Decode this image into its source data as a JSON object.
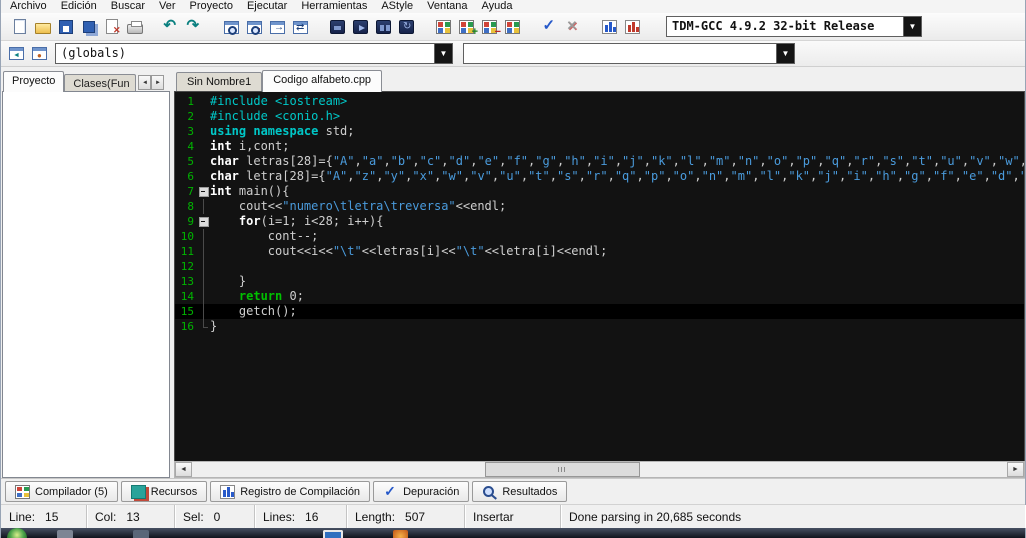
{
  "menu": {
    "items": [
      {
        "label": "Archivo",
        "name": "menu-archivo"
      },
      {
        "label": "Edición",
        "name": "menu-edicion"
      },
      {
        "label": "Buscar",
        "name": "menu-buscar"
      },
      {
        "label": "Ver",
        "name": "menu-ver"
      },
      {
        "label": "Proyecto",
        "name": "menu-proyecto"
      },
      {
        "label": "Ejecutar",
        "name": "menu-ejecutar"
      },
      {
        "label": "Herramientas",
        "name": "menu-herramientas"
      },
      {
        "label": "AStyle",
        "name": "menu-astyle"
      },
      {
        "label": "Ventana",
        "name": "menu-ventana"
      },
      {
        "label": "Ayuda",
        "name": "menu-ayuda"
      }
    ]
  },
  "toolbar1": {
    "groups": [
      {
        "icons": [
          "new-file",
          "open-file",
          "save",
          "save-all",
          "close-file",
          "print"
        ]
      },
      {
        "icons": [
          "undo",
          "redo"
        ]
      },
      {
        "icons": [
          "find",
          "replace",
          "goto-line",
          "swap-header-source"
        ]
      },
      {
        "icons": [
          "compile",
          "run",
          "compile-run",
          "rebuild"
        ]
      },
      {
        "icons": [
          "new-source-file",
          "add-to-project",
          "remove-from-project",
          "project-options"
        ]
      },
      {
        "icons": [
          "syntax-check",
          "abort-compilation"
        ]
      },
      {
        "icons": [
          "profile-analysis",
          "delete-profiling-data"
        ]
      }
    ],
    "compiler_profile": "TDM-GCC 4.9.2 32-bit Release",
    "dropdown_arrow": "▼"
  },
  "toolbar2": {
    "icons": [
      "goto-declaration",
      "goto-definition"
    ],
    "globals_value": "(globals)",
    "members_value": "",
    "dropdown_arrow": "▼"
  },
  "left_panel": {
    "tabs": [
      {
        "label": "Proyecto",
        "active": true
      },
      {
        "label": "Clases(Fun",
        "active": false
      }
    ],
    "scroll_left_icon": "◄",
    "scroll_right_icon": "►"
  },
  "editor": {
    "tabs": [
      {
        "label": "Sin Nombre1",
        "active": false
      },
      {
        "label": "Codigo alfabeto.cpp",
        "active": true
      }
    ],
    "current_line": 15,
    "lines": [
      {
        "n": 1,
        "tk": [
          [
            "#include <iostream>",
            "pp"
          ]
        ]
      },
      {
        "n": 2,
        "tk": [
          [
            "#include <conio.h>",
            "pp"
          ]
        ]
      },
      {
        "n": 3,
        "tk": [
          [
            "using namespace",
            "kwc"
          ],
          [
            " std;",
            "txt"
          ]
        ]
      },
      {
        "n": 4,
        "tk": [
          [
            "int",
            "kw"
          ],
          [
            " i,cont;",
            "txt"
          ]
        ]
      },
      {
        "n": 5,
        "tk": [
          [
            "char",
            "kw"
          ],
          [
            " letras[28]={",
            "txt"
          ],
          [
            "\"A\"",
            "str"
          ],
          [
            ",",
            "txt"
          ],
          [
            "\"a\"",
            "str"
          ],
          [
            ",",
            "txt"
          ],
          [
            "\"b\"",
            "str"
          ],
          [
            ",",
            "txt"
          ],
          [
            "\"c\"",
            "str"
          ],
          [
            ",",
            "txt"
          ],
          [
            "\"d\"",
            "str"
          ],
          [
            ",",
            "txt"
          ],
          [
            "\"e\"",
            "str"
          ],
          [
            ",",
            "txt"
          ],
          [
            "\"f\"",
            "str"
          ],
          [
            ",",
            "txt"
          ],
          [
            "\"g\"",
            "str"
          ],
          [
            ",",
            "txt"
          ],
          [
            "\"h\"",
            "str"
          ],
          [
            ",",
            "txt"
          ],
          [
            "\"i\"",
            "str"
          ],
          [
            ",",
            "txt"
          ],
          [
            "\"j\"",
            "str"
          ],
          [
            ",",
            "txt"
          ],
          [
            "\"k\"",
            "str"
          ],
          [
            ",",
            "txt"
          ],
          [
            "\"l\"",
            "str"
          ],
          [
            ",",
            "txt"
          ],
          [
            "\"m\"",
            "str"
          ],
          [
            ",",
            "txt"
          ],
          [
            "\"n\"",
            "str"
          ],
          [
            ",",
            "txt"
          ],
          [
            "\"o\"",
            "str"
          ],
          [
            ",",
            "txt"
          ],
          [
            "\"p\"",
            "str"
          ],
          [
            ",",
            "txt"
          ],
          [
            "\"q\"",
            "str"
          ],
          [
            ",",
            "txt"
          ],
          [
            "\"r\"",
            "str"
          ],
          [
            ",",
            "txt"
          ],
          [
            "\"s\"",
            "str"
          ],
          [
            ",",
            "txt"
          ],
          [
            "\"t\"",
            "str"
          ],
          [
            ",",
            "txt"
          ],
          [
            "\"u\"",
            "str"
          ],
          [
            ",",
            "txt"
          ],
          [
            "\"v\"",
            "str"
          ],
          [
            ",",
            "txt"
          ],
          [
            "\"w\"",
            "str"
          ],
          [
            ",",
            "txt"
          ],
          [
            "\"x",
            "str"
          ]
        ]
      },
      {
        "n": 6,
        "tk": [
          [
            "char",
            "kw"
          ],
          [
            " letra[28]={",
            "txt"
          ],
          [
            "\"A\"",
            "str"
          ],
          [
            ",",
            "txt"
          ],
          [
            "\"z\"",
            "str"
          ],
          [
            ",",
            "txt"
          ],
          [
            "\"y\"",
            "str"
          ],
          [
            ",",
            "txt"
          ],
          [
            "\"x\"",
            "str"
          ],
          [
            ",",
            "txt"
          ],
          [
            "\"w\"",
            "str"
          ],
          [
            ",",
            "txt"
          ],
          [
            "\"v\"",
            "str"
          ],
          [
            ",",
            "txt"
          ],
          [
            "\"u\"",
            "str"
          ],
          [
            ",",
            "txt"
          ],
          [
            "\"t\"",
            "str"
          ],
          [
            ",",
            "txt"
          ],
          [
            "\"s\"",
            "str"
          ],
          [
            ",",
            "txt"
          ],
          [
            "\"r\"",
            "str"
          ],
          [
            ",",
            "txt"
          ],
          [
            "\"q\"",
            "str"
          ],
          [
            ",",
            "txt"
          ],
          [
            "\"p\"",
            "str"
          ],
          [
            ",",
            "txt"
          ],
          [
            "\"o\"",
            "str"
          ],
          [
            ",",
            "txt"
          ],
          [
            "\"n\"",
            "str"
          ],
          [
            ",",
            "txt"
          ],
          [
            "\"m\"",
            "str"
          ],
          [
            ",",
            "txt"
          ],
          [
            "\"l\"",
            "str"
          ],
          [
            ",",
            "txt"
          ],
          [
            "\"k\"",
            "str"
          ],
          [
            ",",
            "txt"
          ],
          [
            "\"j\"",
            "str"
          ],
          [
            ",",
            "txt"
          ],
          [
            "\"i\"",
            "str"
          ],
          [
            ",",
            "txt"
          ],
          [
            "\"h\"",
            "str"
          ],
          [
            ",",
            "txt"
          ],
          [
            "\"g\"",
            "str"
          ],
          [
            ",",
            "txt"
          ],
          [
            "\"f\"",
            "str"
          ],
          [
            ",",
            "txt"
          ],
          [
            "\"e\"",
            "str"
          ],
          [
            ",",
            "txt"
          ],
          [
            "\"d\"",
            "str"
          ],
          [
            ",",
            "txt"
          ],
          [
            "\"c",
            "str"
          ]
        ]
      },
      {
        "n": 7,
        "fold": "box",
        "tk": [
          [
            "int",
            "kw"
          ],
          [
            " main(){",
            "txt"
          ]
        ]
      },
      {
        "n": 8,
        "fold": "line",
        "tk": [
          [
            "    cout<<",
            "txt"
          ],
          [
            "\"numero\\tletra\\treversa\"",
            "str"
          ],
          [
            "<<endl;",
            "txt"
          ]
        ]
      },
      {
        "n": 9,
        "fold": "box",
        "tk": [
          [
            "    ",
            "txt"
          ],
          [
            "for",
            "kw"
          ],
          [
            "(i=1; i<28; i++){",
            "txt"
          ]
        ]
      },
      {
        "n": 10,
        "fold": "line",
        "tk": [
          [
            "        cont--;",
            "txt"
          ]
        ]
      },
      {
        "n": 11,
        "fold": "line",
        "tk": [
          [
            "        cout<<i<<",
            "txt"
          ],
          [
            "\"\\t\"",
            "str"
          ],
          [
            "<<letras[i]<<",
            "txt"
          ],
          [
            "\"\\t\"",
            "str"
          ],
          [
            "<<letra[i]<<endl;",
            "txt"
          ]
        ]
      },
      {
        "n": 12,
        "fold": "line",
        "tk": []
      },
      {
        "n": 13,
        "fold": "line",
        "tk": [
          [
            "    }",
            "txt"
          ]
        ]
      },
      {
        "n": 14,
        "fold": "line",
        "tk": [
          [
            "    ",
            "txt"
          ],
          [
            "return",
            "kwg"
          ],
          [
            " 0;",
            "txt"
          ]
        ]
      },
      {
        "n": 15,
        "fold": "line",
        "tk": [
          [
            "    getch();",
            "txt"
          ]
        ]
      },
      {
        "n": 16,
        "fold": "end",
        "tk": [
          [
            "}",
            "txt"
          ]
        ]
      }
    ]
  },
  "scrollbar": {
    "left_arrow": "◄",
    "right_arrow": "►"
  },
  "bottom_tabs": [
    {
      "label": "Compilador (5)",
      "icon": "compiler-tab",
      "name": "compiler"
    },
    {
      "label": "Recursos",
      "icon": "resources-tab",
      "name": "resources"
    },
    {
      "label": "Registro de Compilación",
      "icon": "compile-log-tab",
      "name": "compile-log"
    },
    {
      "label": "Depuración",
      "icon": "debug-tab",
      "name": "debug"
    },
    {
      "label": "Resultados",
      "icon": "results-tab",
      "name": "results"
    }
  ],
  "statusbar": {
    "cells": [
      {
        "name": "line-indicator",
        "text": "Line:   15"
      },
      {
        "name": "column-indicator",
        "text": "Col:   13"
      },
      {
        "name": "selection-indicator",
        "text": "Sel:   0"
      },
      {
        "name": "lines-count",
        "text": "Lines:   16"
      },
      {
        "name": "length-indicator",
        "text": "Length:   507"
      },
      {
        "name": "insert-mode",
        "text": "Insertar"
      },
      {
        "name": "parse-status",
        "text": "Done parsing in 20,685 seconds"
      }
    ]
  }
}
